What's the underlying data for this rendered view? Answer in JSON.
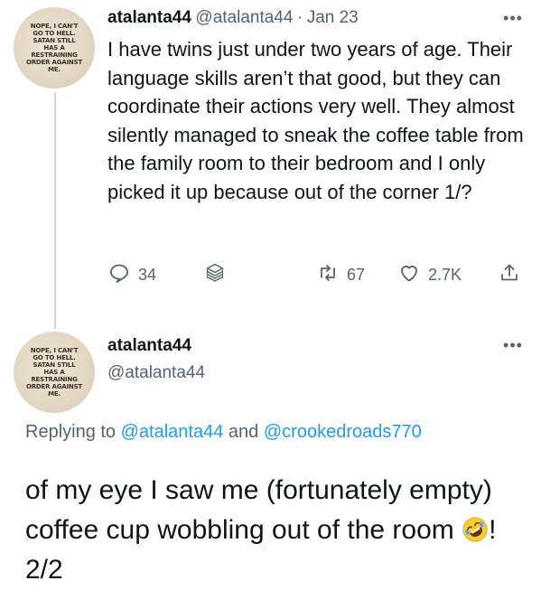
{
  "avatar": {
    "text": "NOPE, I CAN'T GO TO HELL. SATAN STILL HAS A RESTRAINING ORDER AGAINST ME."
  },
  "tweet1": {
    "name": "atalanta44",
    "handle": "@atalanta44",
    "separator": "·",
    "date": "Jan 23",
    "body": "I have twins just under two years of age. Their language skills aren’t that good, but they can coordinate their actions very well. They almost silently managed to sneak the coffee table from the family room to their bedroom and I only picked it up because out of the corner 1/?",
    "more": "•••",
    "replies": "34",
    "retweets": "67",
    "likes": "2.7K"
  },
  "tweet2": {
    "name": "atalanta44",
    "handle": "@atalanta44",
    "more": "•••",
    "replying_prefix": "Replying to",
    "replying_mention1": "@atalanta44",
    "replying_and": "and",
    "replying_mention2": "@crookedroads770",
    "body_text": "of my eye I saw me (fortunately empty) coffee cup wobbling out of the room",
    "emoji": "rolling-on-floor-laughing-emoji",
    "body_end": "! 2/2"
  },
  "colors": {
    "text": "#0f1419",
    "secondary": "#536471",
    "link": "#1d9bf0",
    "thread_line": "#cfd9de"
  }
}
